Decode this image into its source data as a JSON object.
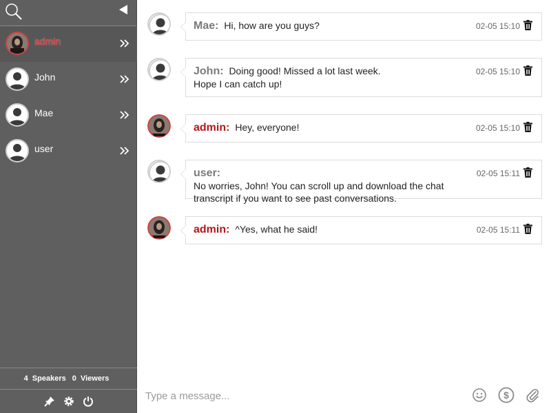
{
  "sidebar": {
    "users": [
      {
        "name": "admin",
        "role": "admin"
      },
      {
        "name": "John",
        "role": "user"
      },
      {
        "name": "Mae",
        "role": "user"
      },
      {
        "name": "user",
        "role": "user"
      }
    ],
    "footer": {
      "speakers_count": "4",
      "speakers_label": "Speakers",
      "viewers_count": "0",
      "viewers_label": "Viewers"
    }
  },
  "messages": [
    {
      "sender": "Mae:",
      "text": "Hi, how are you guys?",
      "time": "02-05 15:10",
      "is_admin": false
    },
    {
      "sender": "John:",
      "text": "Doing good! Missed a lot last week.",
      "text2": "Hope I can catch up!",
      "time": "02-05 15:10",
      "is_admin": false
    },
    {
      "sender": "admin:",
      "text": "Hey, everyone!",
      "time": "02-05 15:10",
      "is_admin": true
    },
    {
      "sender": "user:",
      "text": "No worries, John! You can scroll up and download the chat",
      "text2": "transcript if you want to see past conversations.",
      "time": "02-05 15:11",
      "is_admin": false
    },
    {
      "sender": "admin:",
      "text": "^Yes, what he said!",
      "time": "02-05 15:11",
      "is_admin": true
    }
  ],
  "composer": {
    "placeholder": "Type a message..."
  },
  "colors": {
    "sidebar_bg": "#5f5f5f",
    "admin_red": "#b3171b",
    "sender_gray": "#7a7a7a"
  }
}
